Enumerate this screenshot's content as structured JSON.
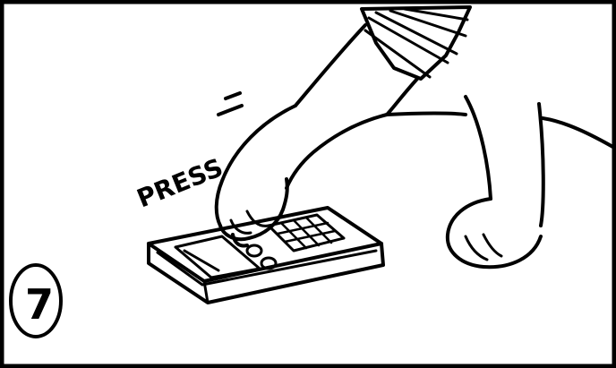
{
  "comic_panel": {
    "sound_effect": "PRESS",
    "panel_number": "7"
  }
}
